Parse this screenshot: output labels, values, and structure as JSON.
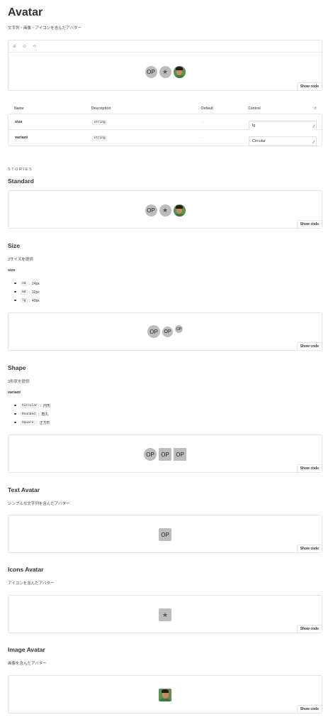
{
  "header": {
    "title": "Avatar",
    "subtitle": "文字列・画像・アイコンを含んだアバター"
  },
  "canvas": {
    "toolbar": [
      "⊕",
      "⊖",
      "⟲"
    ],
    "avatars": {
      "text": "OP",
      "icon": "★"
    },
    "show_code": "Show code"
  },
  "args_table": {
    "headers": {
      "name": "Name",
      "description": "Description",
      "default": "Default",
      "control": "Control",
      "reset": "↺"
    },
    "rows": [
      {
        "name": "size",
        "type": "string",
        "default": "-",
        "value": "lg"
      },
      {
        "name": "variant",
        "type": "string",
        "default": "-",
        "value": "Circular"
      }
    ]
  },
  "stories_label": "STORIES",
  "stories": {
    "standard": {
      "title": "Standard",
      "show_code": "Show code"
    },
    "size": {
      "title": "Size",
      "desc": "3サイズを提供",
      "prop": "size",
      "items": [
        {
          "code": "sm",
          "text": "：24px"
        },
        {
          "code": "md",
          "text": "：32px"
        },
        {
          "code": "lg",
          "text": "：40px"
        }
      ],
      "show_code": "Show code"
    },
    "shape": {
      "title": "Shape",
      "desc": "3形状を提供",
      "prop": "variant",
      "items": [
        {
          "code": "Circular",
          "text": "：円形"
        },
        {
          "code": "Rounded",
          "text": "：角丸"
        },
        {
          "code": "Square",
          "text": "：正方形"
        }
      ],
      "show_code": "Show code"
    },
    "text_avatar": {
      "title": "Text Avatar",
      "desc": "シンプルな文字列を含んだアバター",
      "show_code": "Show code"
    },
    "icons_avatar": {
      "title": "Icons Avatar",
      "desc": "アイコンを含んだアバター",
      "show_code": "Show code"
    },
    "image_avatar": {
      "title": "Image Avatar",
      "desc": "画像を含んだアバター",
      "show_code": "Show code"
    }
  },
  "colors": {
    "avatar_bg": "#bdbdbd",
    "border": "#e2e4e7"
  }
}
